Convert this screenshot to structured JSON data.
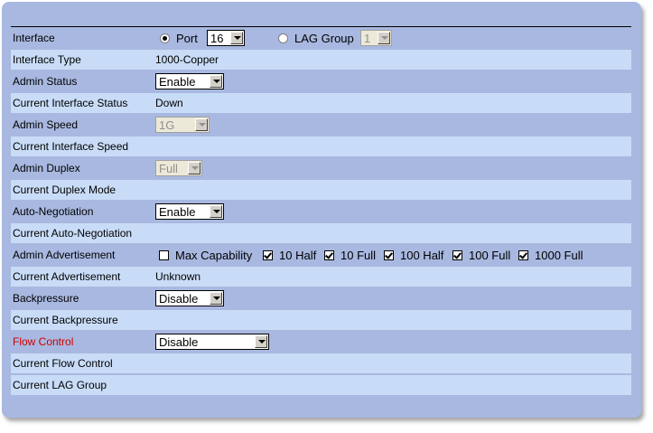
{
  "rows": {
    "interface": {
      "label": "Interface",
      "port_label": "Port",
      "port_value": "16",
      "lag_label": "LAG Group",
      "lag_value": "1"
    },
    "interface_type": {
      "label": "Interface Type",
      "value": "1000-Copper"
    },
    "admin_status": {
      "label": "Admin Status",
      "value": "Enable"
    },
    "current_interface_status": {
      "label": "Current Interface Status",
      "value": "Down"
    },
    "admin_speed": {
      "label": "Admin Speed",
      "value": "1G"
    },
    "current_interface_speed": {
      "label": "Current Interface Speed",
      "value": ""
    },
    "admin_duplex": {
      "label": "Admin Duplex",
      "value": "Full"
    },
    "current_duplex_mode": {
      "label": "Current Duplex Mode",
      "value": ""
    },
    "auto_negotiation": {
      "label": "Auto-Negotiation",
      "value": "Enable"
    },
    "current_auto_negotiation": {
      "label": "Current Auto-Negotiation",
      "value": ""
    },
    "admin_advertisement": {
      "label": "Admin Advertisement",
      "options": [
        {
          "label": "Max Capability",
          "checked": false
        },
        {
          "label": "10 Half",
          "checked": true
        },
        {
          "label": "10 Full",
          "checked": true
        },
        {
          "label": "100 Half",
          "checked": true
        },
        {
          "label": "100 Full",
          "checked": true
        },
        {
          "label": "1000 Full",
          "checked": true
        }
      ]
    },
    "current_advertisement": {
      "label": "Current Advertisement",
      "value": "Unknown"
    },
    "backpressure": {
      "label": "Backpressure",
      "value": "Disable"
    },
    "current_backpressure": {
      "label": "Current Backpressure",
      "value": ""
    },
    "flow_control": {
      "label": "Flow Control",
      "value": "Disable"
    },
    "current_flow_control": {
      "label": "Current Flow Control",
      "value": ""
    },
    "current_lag_group": {
      "label": "Current LAG Group",
      "value": ""
    }
  },
  "colors": {
    "panel_bg": "#a8b8e0",
    "row_light": "#c9dcf7",
    "flow_control_label": "#d00000"
  },
  "interface_selected": "port"
}
